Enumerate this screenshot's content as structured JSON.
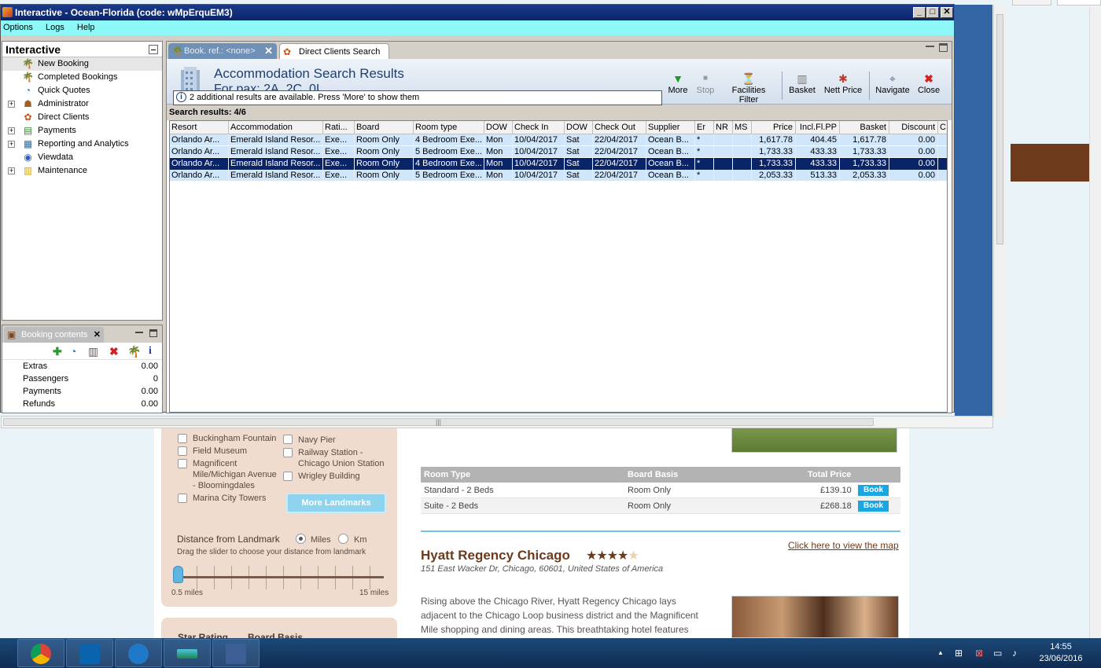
{
  "window": {
    "title": "Interactive - Ocean-Florida (code: wMpErquEM3)",
    "minimize_glyph": "_",
    "maximize_glyph": "□",
    "close_glyph": "✕"
  },
  "menu": {
    "items": [
      "Options",
      "Logs",
      "Help"
    ]
  },
  "left_pane": {
    "title": "Interactive",
    "items": [
      {
        "label": "New Booking",
        "icon": "palm-tree-icon",
        "expandable": false
      },
      {
        "label": "Completed Bookings",
        "icon": "palm-tree-icon",
        "expandable": false
      },
      {
        "label": "Quick Quotes",
        "icon": "clock-icon",
        "expandable": false
      },
      {
        "label": "Administrator",
        "icon": "admin-user-icon",
        "expandable": true
      },
      {
        "label": "Direct Clients",
        "icon": "direct-clients-icon",
        "expandable": false
      },
      {
        "label": "Payments",
        "icon": "payments-icon",
        "expandable": true
      },
      {
        "label": "Reporting and Analytics",
        "icon": "report-icon",
        "expandable": true
      },
      {
        "label": "Viewdata",
        "icon": "globe-icon",
        "expandable": false
      },
      {
        "label": "Maintenance",
        "icon": "maintenance-icon",
        "expandable": true
      }
    ]
  },
  "booking_contents": {
    "tab_label": "Booking contents",
    "rows": [
      {
        "label": "Extras",
        "value": "0.00"
      },
      {
        "label": "Passengers",
        "value": "0"
      },
      {
        "label": "Payments",
        "value": "0.00"
      },
      {
        "label": "Refunds",
        "value": "0.00"
      }
    ]
  },
  "main": {
    "tabs": [
      {
        "label": "Book. ref.: <none>",
        "active": true
      },
      {
        "label": "Direct Clients Search",
        "active": false
      }
    ],
    "header_title": "Accommodation Search Results",
    "header_subtitle": "For pax: 2A, 2C, 0I",
    "info_message": "2 additional results are available. Press 'More' to show them",
    "toolbar": {
      "more": "More",
      "stop": "Stop",
      "facilities_filter": "Facilities Filter",
      "basket": "Basket",
      "nett_price": "Nett Price",
      "navigate": "Navigate",
      "close": "Close"
    },
    "search_results_label": "Search results: 4/6",
    "columns": [
      "Resort",
      "Accommodation",
      "Rati...",
      "Board",
      "Room type",
      "DOW",
      "Check In",
      "DOW",
      "Check Out",
      "Supplier",
      "Er",
      "NR",
      "MS",
      "Price",
      "Incl.Fl.PP",
      "Basket",
      "Discount",
      "C"
    ],
    "rows": [
      {
        "selected": false,
        "cells": [
          "Orlando Ar...",
          "Emerald Island Resor...",
          "Exe...",
          "Room Only",
          "4 Bedroom Exe...",
          "Mon",
          "10/04/2017",
          "Sat",
          "22/04/2017",
          "Ocean B...",
          "*",
          "",
          "",
          "1,617.78",
          "404.45",
          "1,617.78",
          "0.00",
          ""
        ]
      },
      {
        "selected": false,
        "cells": [
          "Orlando Ar...",
          "Emerald Island Resor...",
          "Exe...",
          "Room Only",
          "5 Bedroom Exe...",
          "Mon",
          "10/04/2017",
          "Sat",
          "22/04/2017",
          "Ocean B...",
          "*",
          "",
          "",
          "1,733.33",
          "433.33",
          "1,733.33",
          "0.00",
          ""
        ]
      },
      {
        "selected": true,
        "cells": [
          "Orlando Ar...",
          "Emerald Island Resor...",
          "Exe...",
          "Room Only",
          "4 Bedroom Exe...",
          "Mon",
          "10/04/2017",
          "Sat",
          "22/04/2017",
          "Ocean B...",
          "*",
          "",
          "",
          "1,733.33",
          "433.33",
          "1,733.33",
          "0.00",
          ""
        ]
      },
      {
        "selected": false,
        "cells": [
          "Orlando Ar...",
          "Emerald Island Resor...",
          "Exe...",
          "Room Only",
          "5 Bedroom Exe...",
          "Mon",
          "10/04/2017",
          "Sat",
          "22/04/2017",
          "Ocean B...",
          "*",
          "",
          "",
          "2,053.33",
          "513.33",
          "2,053.33",
          "0.00",
          ""
        ]
      }
    ]
  },
  "background_page": {
    "landmarks_left": [
      "Buckingham Fountain",
      "Field Museum",
      "Magnificent Mile/Michigan Avenue - Bloomingdales",
      "Marina City Towers"
    ],
    "landmarks_right": [
      "Navy Pier",
      "Railway Station - Chicago Union Station",
      "Wrigley Building"
    ],
    "more_landmarks": "More Landmarks",
    "distance_title": "Distance from Landmark",
    "miles": "Miles",
    "km": "Km",
    "drag_hint": "Drag the slider to choose your distance from landmark",
    "slider_min": "0.5 miles",
    "slider_max": "15 miles",
    "star_rating": "Star Rating",
    "board_basis_filter": "Board Basis",
    "room_table": {
      "headers": [
        "Room Type",
        "Board Basis",
        "Total Price"
      ],
      "rows": [
        {
          "room": "Standard - 2 Beds",
          "board": "Room Only",
          "price": "£139.10",
          "book": "Book"
        },
        {
          "room": "Suite - 2 Beds",
          "board": "Room Only",
          "price": "£268.18",
          "book": "Book"
        }
      ]
    },
    "hotel_name": "Hyatt Regency Chicago",
    "hotel_stars": "★★★★",
    "hotel_star_empty": "★",
    "map_link": "Click here to view the map",
    "hotel_address": "151 East Wacker Dr, Chicago, 60601, United States of America",
    "hotel_description": "Rising above the Chicago River, Hyatt Regency Chicago lays adjacent to the Chicago Loop business district and the Magnificent Mile shopping and dining areas. This breathtaking hotel features"
  },
  "taskbar": {
    "time": "14:55",
    "date": "23/06/2016"
  }
}
